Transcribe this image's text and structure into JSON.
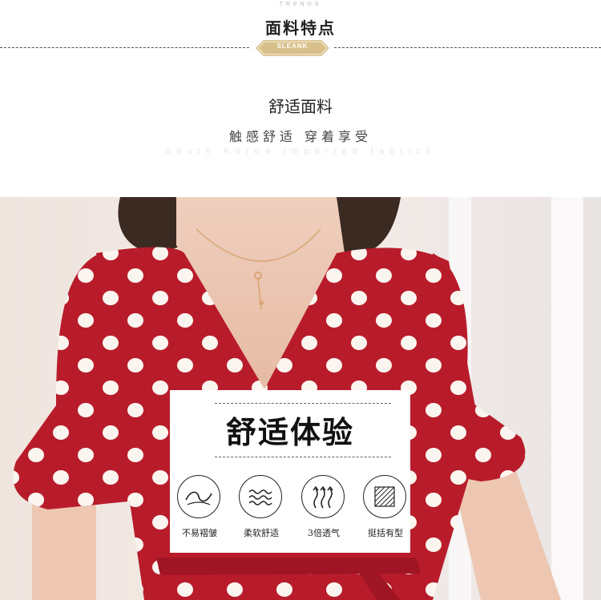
{
  "header": {
    "kicker": "TRENDS",
    "title": "面料特点",
    "badge": "SLEANK"
  },
  "fabric": {
    "heading": "舒适面料",
    "tagline": "触感舒适   穿着享受",
    "subtitle": "South Korea imported fabrics"
  },
  "card": {
    "title": "舒适体验",
    "features": [
      {
        "icon": "wrinkle-free-icon",
        "label": "不易褶皱"
      },
      {
        "icon": "soft-wave-icon",
        "label": "柔软舒适"
      },
      {
        "icon": "breathable-icon",
        "label": "3倍透气"
      },
      {
        "icon": "stiff-fabric-icon",
        "label": "挺括有型"
      }
    ]
  },
  "colors": {
    "dress_red": "#b81c2a",
    "dot_white": "#fbf5f0",
    "badge_gold": "#d8c08a"
  }
}
